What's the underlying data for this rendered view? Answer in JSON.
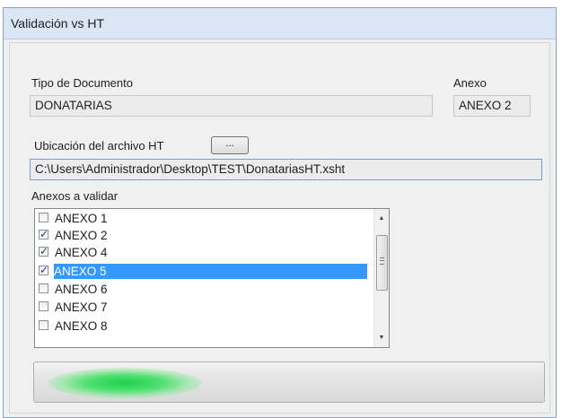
{
  "window": {
    "title": "Validación vs HT"
  },
  "tipo_documento": {
    "label": "Tipo de Documento",
    "value": "DONATARIAS"
  },
  "anexo": {
    "label": "Anexo",
    "value": "ANEXO 2"
  },
  "ubicacion": {
    "label": "Ubicación del archivo HT",
    "browse_label": "...",
    "path": "C:\\Users\\Administrador\\Desktop\\TEST\\DonatariasHT.xsht"
  },
  "anexos_validar": {
    "label": "Anexos a validar",
    "items": [
      {
        "label": "ANEXO 1",
        "checked": false,
        "selected": false
      },
      {
        "label": "ANEXO 2",
        "checked": true,
        "selected": false
      },
      {
        "label": "ANEXO 4",
        "checked": true,
        "selected": false
      },
      {
        "label": "ANEXO 5",
        "checked": true,
        "selected": true
      },
      {
        "label": "ANEXO 6",
        "checked": false,
        "selected": false
      },
      {
        "label": "ANEXO 7",
        "checked": false,
        "selected": false
      },
      {
        "label": "ANEXO 8",
        "checked": false,
        "selected": false
      }
    ]
  },
  "progress": {
    "state": "marquee",
    "accent": "#20d04a"
  },
  "colors": {
    "selection": "#3399ff",
    "check": "#1c3f83"
  }
}
